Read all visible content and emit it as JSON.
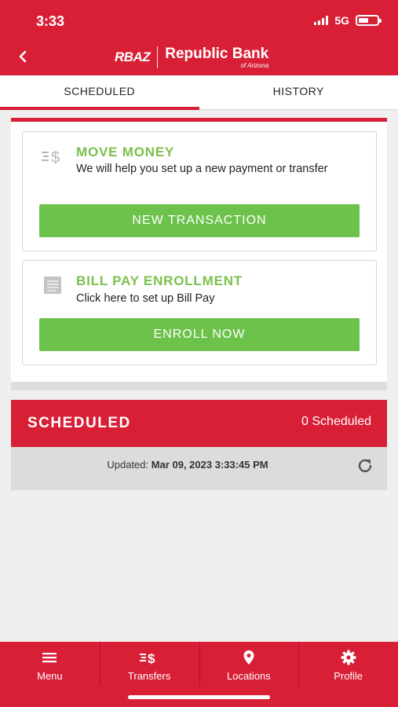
{
  "status_bar": {
    "time": "3:33",
    "network": "5G"
  },
  "header": {
    "logo_mark": "RBAZ",
    "bank_name": "Republic Bank",
    "bank_sub": "of Arizona",
    "back_icon": "chevron-left-icon"
  },
  "tabs": [
    {
      "label": "SCHEDULED",
      "active": true
    },
    {
      "label": "HISTORY",
      "active": false
    }
  ],
  "cards": {
    "move_money": {
      "icon": "transfer-dollar-icon",
      "title": "MOVE MONEY",
      "description": "We will help you set up a new payment or transfer",
      "button": "NEW TRANSACTION"
    },
    "bill_pay": {
      "icon": "document-icon",
      "title": "BILL PAY ENROLLMENT",
      "description": "Click here to set up Bill Pay",
      "button": "ENROLL NOW"
    }
  },
  "scheduled": {
    "title": "SCHEDULED",
    "count": "0 Scheduled",
    "updated_label": "Updated:",
    "updated_value": "Mar 09, 2023 3:33:45 PM"
  },
  "bottom_nav": [
    {
      "label": "Menu",
      "icon": "hamburger-icon"
    },
    {
      "label": "Transfers",
      "icon": "transfer-dollar-icon"
    },
    {
      "label": "Locations",
      "icon": "location-pin-icon"
    },
    {
      "label": "Profile",
      "icon": "gear-icon"
    }
  ],
  "colors": {
    "brand_red": "#d81f36",
    "accent_green": "#6cc24a",
    "title_green": "#7ac14b"
  }
}
